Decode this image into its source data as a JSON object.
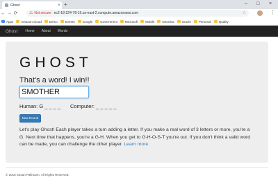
{
  "browser": {
    "tab_title": "Ghost",
    "tab_close": "×",
    "new_tab": "+",
    "window_controls": {
      "minimize": "–",
      "maximize": "□",
      "close": "×"
    },
    "nav": {
      "back": "←",
      "forward": "→",
      "reload": "⟳"
    },
    "security_label": "Not secure",
    "url": "ec2-18-224-78-19.us-east-2.compute.amazonaws.com",
    "bookmarks": [
      "Apps",
      "Amazon Cloud",
      "Demo",
      "Events",
      "Google",
      "Government",
      "Microsoft",
      "Mobile",
      "Nexxtiva",
      "Oracle",
      "Personal",
      "Quality"
    ]
  },
  "site": {
    "brand": "Ghost",
    "nav_links": [
      "Home",
      "About",
      "Words"
    ]
  },
  "game": {
    "title": "GHOST",
    "message": "That's a word! I win!!",
    "word_value": "SMOTHER",
    "human_label": "Human: G _ _ _ _",
    "computer_label": "Computer: _ _ _ _ _",
    "new_round_label": "New Round",
    "rules_text": "Let's play Ghost! Each player takes a turn adding a letter. If you make a real word of 3 letters or more, you're a G. Next time that happens, you're a G-H. When you get to G-H-O-S-T you're out. If you don't think a valid word can be made, you can challenge the other player.",
    "learn_more": "Learn more"
  },
  "footer": {
    "copyright": "© 2018 Susan Pallmann. All Rights Reserved."
  },
  "colors": {
    "navbar_bg": "#222222",
    "jumbotron_bg": "#eeeeee",
    "primary_button": "#337ab7",
    "input_focus": "#66afe9",
    "not_secure": "#d93025"
  }
}
